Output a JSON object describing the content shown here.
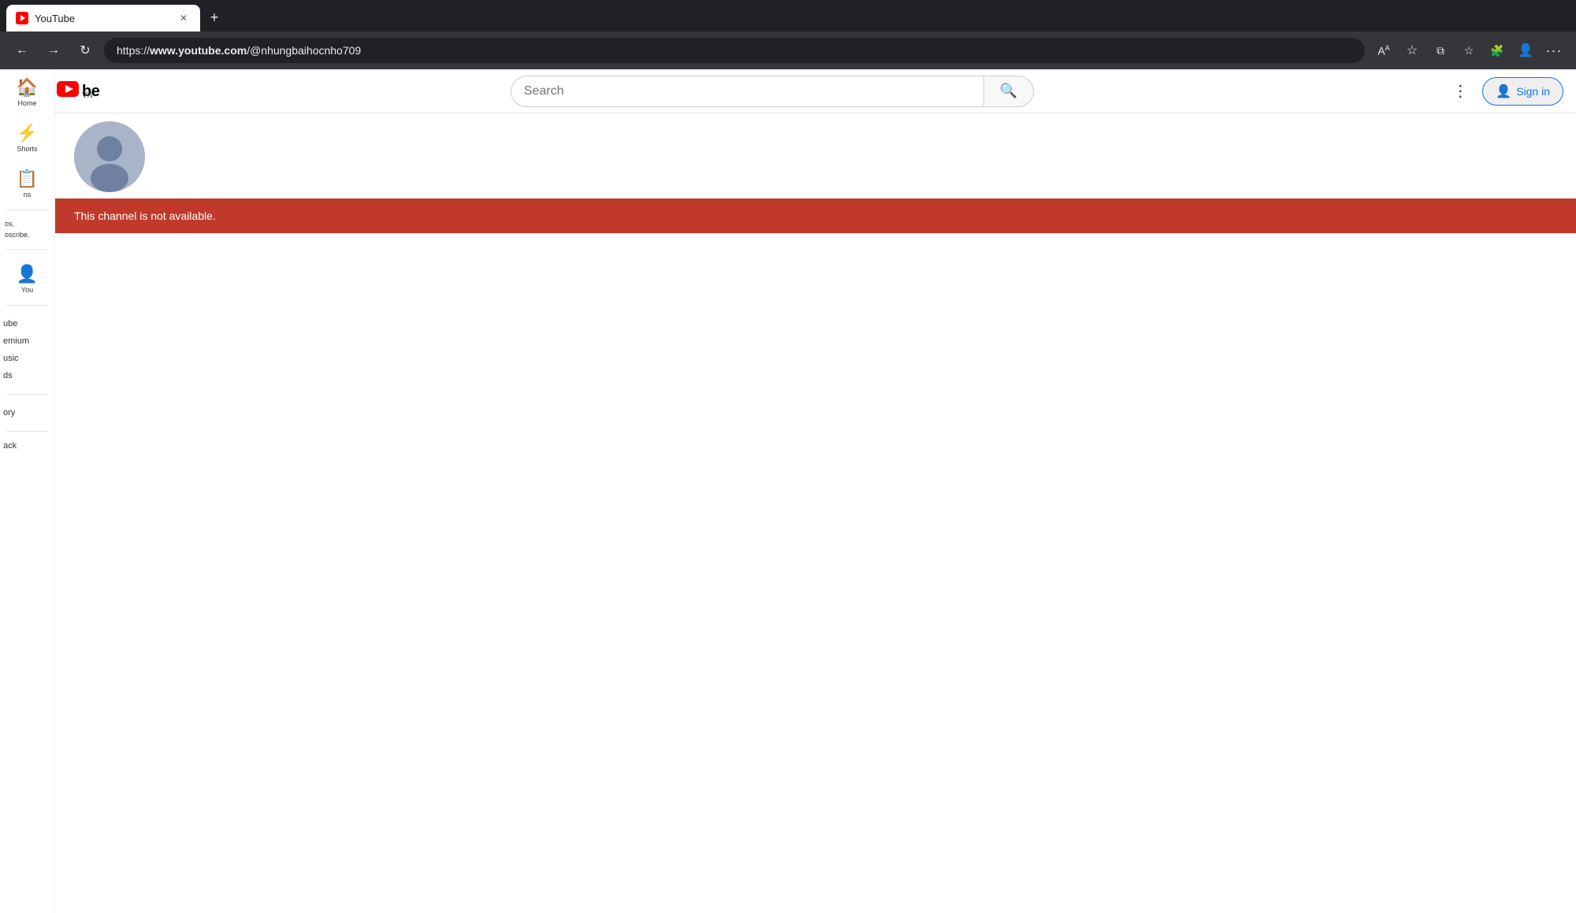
{
  "browser": {
    "tab": {
      "title": "YouTube",
      "favicon": "yt-favicon"
    },
    "new_tab_label": "+",
    "address": "https://",
    "address_bold": "www.youtube.com",
    "address_rest": "/@nhungbaihocnho709",
    "full_url": "https://www.youtube.com/@nhungbaihocnho709"
  },
  "header": {
    "logo_text": "be",
    "logo_country": "VN",
    "search_placeholder": "Search",
    "sign_in_label": "Sign in",
    "more_options_label": "⋮"
  },
  "channel": {
    "avatar_alt": "channel avatar",
    "error_message": "This channel is not available."
  },
  "sidebar": {
    "footer_sections": [
      {
        "label": "ube"
      },
      {
        "label": "emium"
      },
      {
        "label": "usic"
      },
      {
        "label": "ds"
      },
      {
        "label": "ory"
      },
      {
        "label": "ack"
      }
    ],
    "left_partial": {
      "line1": "ns",
      "line2": "os,",
      "line3": "oscribe."
    }
  },
  "icons": {
    "search": "🔍",
    "person": "👤",
    "more_vert": "⋮",
    "close": "✕",
    "new_tab": "+",
    "back": "←",
    "forward": "→",
    "refresh": "↻",
    "font_size": "A",
    "star": "☆",
    "extensions": "🧩",
    "profile": "👤",
    "ellipsis": "…"
  }
}
